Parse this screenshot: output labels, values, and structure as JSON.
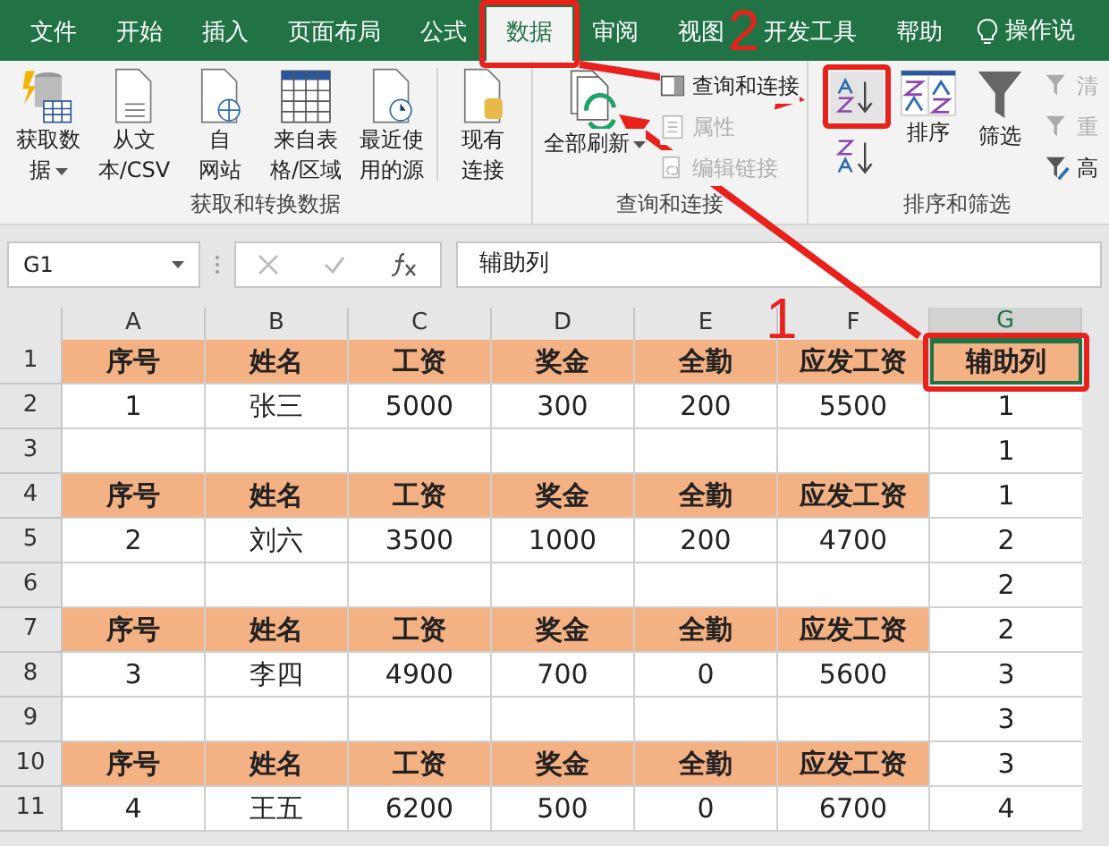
{
  "tabs": [
    {
      "label": "文件",
      "selected": false
    },
    {
      "label": "开始",
      "selected": false
    },
    {
      "label": "插入",
      "selected": false
    },
    {
      "label": "页面布局",
      "selected": false
    },
    {
      "label": "公式",
      "selected": false
    },
    {
      "label": "数据",
      "selected": true
    },
    {
      "label": "审阅",
      "selected": false
    },
    {
      "label": "视图",
      "selected": false
    },
    {
      "label": "开发工具",
      "selected": false
    },
    {
      "label": "帮助",
      "selected": false
    }
  ],
  "tell_me": "操作说",
  "ribbon": [
    {
      "label": "获取和转换数据",
      "items": [
        {
          "kind": "large",
          "lines": [
            "获取数",
            "据"
          ],
          "dropdown": true
        },
        {
          "kind": "large",
          "lines": [
            "从文",
            "本/CSV"
          ],
          "dropdown": false
        },
        {
          "kind": "large",
          "lines": [
            "自",
            "网站"
          ],
          "dropdown": false
        },
        {
          "kind": "large",
          "lines": [
            "来自表",
            "格/区域"
          ],
          "dropdown": false
        },
        {
          "kind": "large",
          "lines": [
            "最近使",
            "用的源"
          ],
          "dropdown": false
        },
        {
          "kind": "separator"
        },
        {
          "kind": "large",
          "lines": [
            "现有",
            "连接"
          ],
          "dropdown": false
        }
      ]
    },
    {
      "label": "查询和连接",
      "items": [
        {
          "kind": "large",
          "lines": [
            "全部刷新"
          ],
          "dropdown": true
        },
        {
          "kind": "small",
          "label": "查询和连接",
          "disabled": false
        },
        {
          "kind": "small",
          "label": "属性",
          "disabled": true
        },
        {
          "kind": "small",
          "label": "编辑链接",
          "disabled": true
        }
      ]
    },
    {
      "label": "排序和筛选",
      "items": [
        {
          "kind": "sort",
          "selected": true
        },
        {
          "kind": "large",
          "lines": [
            "排序"
          ],
          "dropdown": false
        },
        {
          "kind": "large",
          "lines": [
            "筛选"
          ],
          "dropdown": false
        },
        {
          "kind": "small",
          "label": "清",
          "disabled": true
        },
        {
          "kind": "small",
          "label": "重",
          "disabled": true
        },
        {
          "kind": "small",
          "label": "高",
          "disabled": false
        }
      ]
    }
  ],
  "name_box": "G1",
  "formula": "辅助列",
  "columns": [
    {
      "label": "A",
      "selected": false
    },
    {
      "label": "B",
      "selected": false
    },
    {
      "label": "C",
      "selected": false
    },
    {
      "label": "D",
      "selected": false
    },
    {
      "label": "E",
      "selected": false
    },
    {
      "label": "F",
      "selected": false
    },
    {
      "label": "G",
      "selected": true
    }
  ],
  "rows": [
    {
      "number": "1",
      "kind": "header",
      "cells": [
        "序号",
        "姓名",
        "工资",
        "奖金",
        "全勤",
        "应发工资"
      ],
      "helper": {
        "text": "辅助列",
        "kind": "header",
        "selected": true
      }
    },
    {
      "number": "2",
      "kind": "data",
      "cells": [
        "1",
        "张三",
        "5000",
        "300",
        "200",
        "5500"
      ],
      "helper": {
        "text": "1",
        "kind": "data",
        "selected": false
      }
    },
    {
      "number": "3",
      "kind": "blank",
      "cells": [],
      "helper": {
        "text": "1",
        "kind": "data",
        "selected": false
      }
    },
    {
      "number": "4",
      "kind": "header",
      "cells": [
        "序号",
        "姓名",
        "工资",
        "奖金",
        "全勤",
        "应发工资"
      ],
      "helper": {
        "text": "1",
        "kind": "data",
        "selected": false
      }
    },
    {
      "number": "5",
      "kind": "data",
      "cells": [
        "2",
        "刘六",
        "3500",
        "1000",
        "200",
        "4700"
      ],
      "helper": {
        "text": "2",
        "kind": "data",
        "selected": false
      }
    },
    {
      "number": "6",
      "kind": "blank",
      "cells": [],
      "helper": {
        "text": "2",
        "kind": "data",
        "selected": false
      }
    },
    {
      "number": "7",
      "kind": "header",
      "cells": [
        "序号",
        "姓名",
        "工资",
        "奖金",
        "全勤",
        "应发工资"
      ],
      "helper": {
        "text": "2",
        "kind": "data",
        "selected": false
      }
    },
    {
      "number": "8",
      "kind": "data",
      "cells": [
        "3",
        "李四",
        "4900",
        "700",
        "0",
        "5600"
      ],
      "helper": {
        "text": "3",
        "kind": "data",
        "selected": false
      }
    },
    {
      "number": "9",
      "kind": "blank",
      "cells": [],
      "helper": {
        "text": "3",
        "kind": "data",
        "selected": false
      }
    },
    {
      "number": "10",
      "kind": "header",
      "cells": [
        "序号",
        "姓名",
        "工资",
        "奖金",
        "全勤",
        "应发工资"
      ],
      "helper": {
        "text": "3",
        "kind": "data",
        "selected": false
      }
    },
    {
      "number": "11",
      "kind": "data",
      "cells": [
        "4",
        "王五",
        "6200",
        "500",
        "0",
        "6700"
      ],
      "helper": {
        "text": "4",
        "kind": "data",
        "selected": false
      }
    }
  ],
  "annotation_numbers": [
    "2",
    "1"
  ]
}
